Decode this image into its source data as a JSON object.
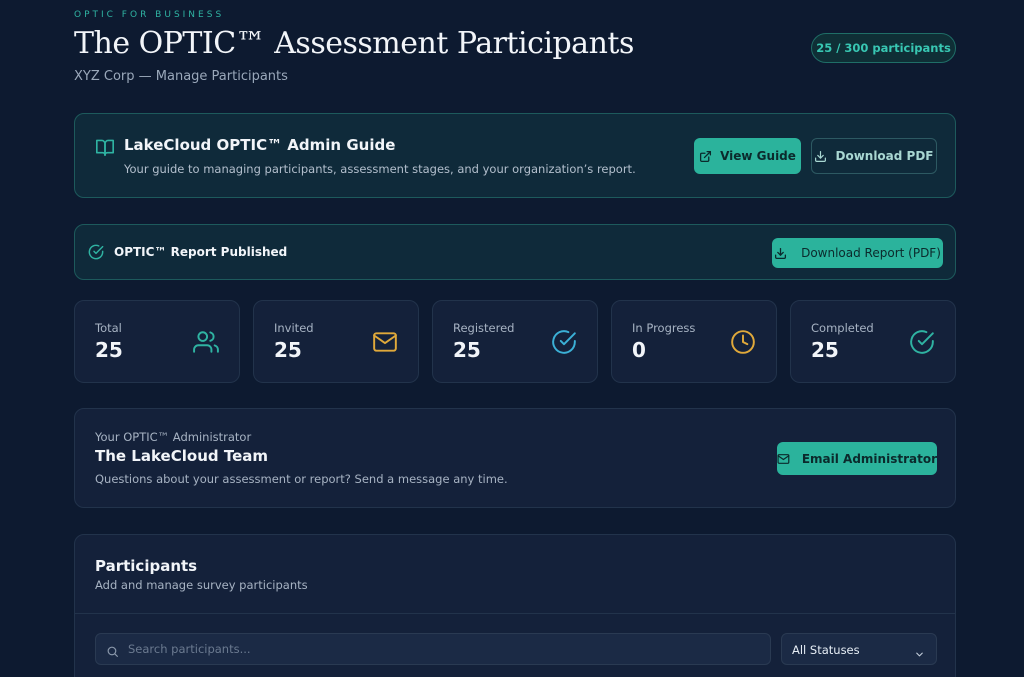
{
  "header": {
    "eyebrow": "OPTIC FOR BUSINESS",
    "title": "The OPTIC™ Assessment Participants",
    "subtitle": "XYZ Corp — Manage Participants",
    "participant_count": "25 / 300 participants"
  },
  "guide": {
    "title": "LakeCloud OPTIC™ Admin Guide",
    "description": "Your guide to managing participants, assessment stages, and your organization’s report.",
    "view_label": "View Guide",
    "download_label": "Download PDF"
  },
  "report": {
    "status": "OPTIC™ Report Published",
    "download_label": "Download Report (PDF)"
  },
  "stats": [
    {
      "label": "Total",
      "value": "25",
      "icon": "users-icon",
      "color": "#2fb3a2"
    },
    {
      "label": "Invited",
      "value": "25",
      "icon": "mail-icon",
      "color": "#e0a93a"
    },
    {
      "label": "Registered",
      "value": "25",
      "icon": "check-circle-icon",
      "color": "#3bb0d6"
    },
    {
      "label": "In Progress",
      "value": "0",
      "icon": "clock-icon",
      "color": "#e0a93a"
    },
    {
      "label": "Completed",
      "value": "25",
      "icon": "check-circle-icon",
      "color": "#2fb3a2"
    }
  ],
  "admin": {
    "eyebrow": "Your OPTIC™ Administrator",
    "name": "The LakeCloud Team",
    "description": "Questions about your assessment or report? Send a message any time.",
    "email_label": "Email Administrator"
  },
  "participants": {
    "title": "Participants",
    "subtitle": "Add and manage survey participants",
    "search_placeholder": "Search participants...",
    "status_filter": "All Statuses"
  },
  "colors": {
    "accent": "#2bb39c",
    "background": "#0d1a30",
    "card": "#14213a"
  }
}
